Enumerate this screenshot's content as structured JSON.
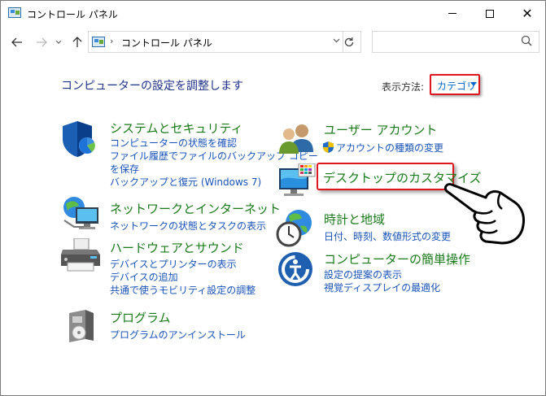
{
  "window": {
    "title": "コントロール パネル",
    "controls": {
      "minimize": "minimize",
      "maximize": "maximize",
      "close": "✕"
    }
  },
  "address_bar": {
    "breadcrumb": "コントロール パネル",
    "separator": "›",
    "search_placeholder": ""
  },
  "header": {
    "title": "コンピューターの設定を調整します",
    "view_label": "表示方法:",
    "view_value": "カテゴリ"
  },
  "categories_left": [
    {
      "title": "システムとセキュリティ",
      "icon": "shield-icon",
      "links": [
        "コンピューターの状態を確認",
        "ファイル履歴でファイルのバックアップ コピー",
        "を保存",
        "バックアップと復元 (Windows 7)"
      ]
    },
    {
      "title": "ネットワークとインターネット",
      "icon": "network-icon",
      "links": [
        "ネットワークの状態とタスクの表示"
      ]
    },
    {
      "title": "ハードウェアとサウンド",
      "icon": "printer-icon",
      "links": [
        "デバイスとプリンターの表示",
        "デバイスの追加",
        "共通で使うモビリティ設定の調整"
      ]
    },
    {
      "title": "プログラム",
      "icon": "programs-icon",
      "links": [
        "プログラムのアンインストール"
      ]
    }
  ],
  "categories_right": [
    {
      "title": "ユーザー アカウント",
      "icon": "users-icon",
      "links": [
        "アカウントの種類の変更"
      ]
    },
    {
      "title": "デスクトップのカスタマイズ",
      "icon": "desktop-icon",
      "links": []
    },
    {
      "title": "時計と地域",
      "icon": "clock-globe-icon",
      "links": [
        "日付、時刻、数値形式の変更"
      ]
    },
    {
      "title": "コンピューターの簡単操作",
      "icon": "ease-of-access-icon",
      "links": [
        "設定の提案の表示",
        "視覚ディスプレイの最適化"
      ]
    }
  ],
  "colors": {
    "title_blue": "#1e3287",
    "category_green": "#1a7a1a",
    "link_blue": "#1a53b8",
    "highlight_red": "#e0161f"
  }
}
